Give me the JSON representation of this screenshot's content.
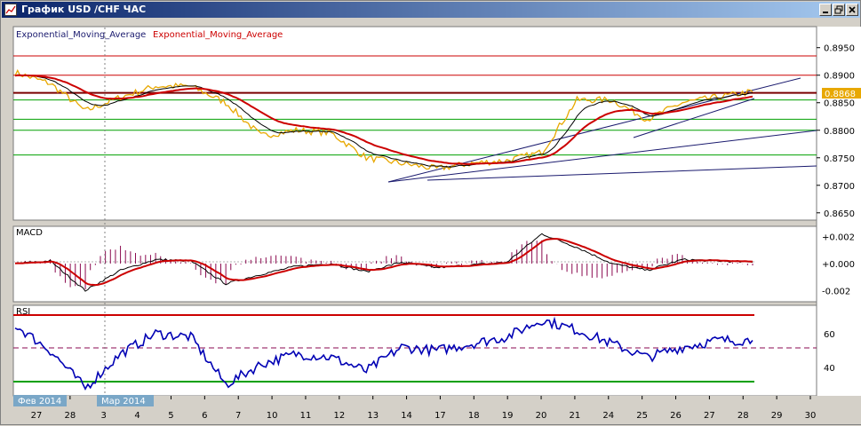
{
  "window": {
    "title": "График USD /CHF  ЧАС",
    "buttons": [
      "minimize",
      "restore",
      "close"
    ]
  },
  "main": {
    "indicator_labels": [
      "Exponential_Moving_Average",
      "Exponential_Moving_Average"
    ],
    "price_ticks": [
      "0.8950",
      "0.8900",
      "0.8850",
      "0.8800",
      "0.8750",
      "0.8700",
      "0.8650"
    ],
    "current_price": "0.8868"
  },
  "macd": {
    "label": "MACD",
    "ticks": [
      "+0.002",
      "+0.000",
      "-0.002"
    ]
  },
  "rsi": {
    "label": "RSI",
    "ticks": [
      "60",
      "40"
    ]
  },
  "x_axis": {
    "ticks": [
      "27",
      "28",
      "3",
      "4",
      "5",
      "6",
      "7",
      "10",
      "11",
      "12",
      "13",
      "14",
      "17",
      "18",
      "19",
      "20",
      "21",
      "24",
      "25",
      "26",
      "27",
      "28",
      "29",
      "30"
    ],
    "month_labels": [
      "Фев 2014",
      "Мар 2014"
    ]
  },
  "colors": {
    "price_line": "#e8a800",
    "ema_fast": "#000000",
    "ema_slow": "#cc0000",
    "macd_hist": "#8b0a50",
    "rsi_line": "#0000b4",
    "rsi_overbought": "#ff00ff",
    "rsi_oversold": "#00e000",
    "resistance": "#cc0000",
    "support": "#00a000",
    "trendline": "#1a1a6e",
    "current_price_bg": "#e8a800"
  },
  "chart_data": {
    "type": "line",
    "title": "",
    "x": [
      "27",
      "28",
      "3",
      "4",
      "5",
      "6",
      "7",
      "10",
      "11",
      "12",
      "13",
      "14",
      "17",
      "18",
      "19",
      "20",
      "21",
      "24",
      "25",
      "26",
      "27",
      "28"
    ],
    "series": [
      {
        "values": [
          0.8905,
          0.8885,
          0.8835,
          0.886,
          0.888,
          0.888,
          0.885,
          0.879,
          0.88,
          0.8795,
          0.875,
          0.874,
          0.873,
          0.874,
          0.8745,
          0.876,
          0.8855,
          0.8855,
          0.882,
          0.885,
          0.886,
          0.887
        ]
      }
    ],
    "price_levels": {
      "red": [
        0.8935,
        0.89,
        0.8868
      ],
      "green": [
        0.8855,
        0.882,
        0.88,
        0.8755
      ]
    },
    "ylim": [
      0.864,
      0.8985
    ],
    "macd": {
      "ylim": [
        -0.0025,
        0.0025
      ],
      "values": [
        0.0,
        0.0002,
        -0.002,
        -0.0005,
        0.0003,
        0.0002,
        -0.0015,
        -0.0008,
        -0.0002,
        0.0,
        -0.0006,
        0.0001,
        -0.0003,
        -0.0001,
        0.0001,
        0.0022,
        0.0012,
        0.0,
        -0.0005,
        0.0003,
        0.0002,
        0.0001
      ]
    },
    "rsi": {
      "ylim": [
        25,
        75
      ],
      "levels": [
        70,
        50,
        30
      ],
      "values": [
        65,
        50,
        28,
        48,
        60,
        58,
        30,
        42,
        48,
        46,
        38,
        52,
        50,
        54,
        58,
        68,
        62,
        54,
        46,
        52,
        56,
        56
      ]
    }
  }
}
